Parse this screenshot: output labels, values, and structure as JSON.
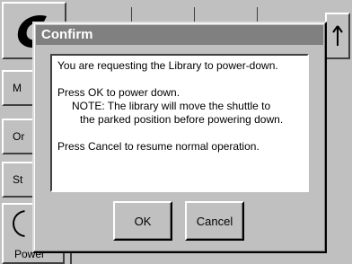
{
  "background": {
    "side_buttons": [
      {
        "label": "M"
      },
      {
        "label": "Or"
      },
      {
        "label": "St"
      }
    ],
    "power_label": "Power"
  },
  "dialog": {
    "title": "Confirm",
    "message": {
      "line1": "You are requesting the Library to power-down.",
      "line2": "Press OK to power down.",
      "note_line1": "NOTE: The library will move the shuttle to",
      "note_line2": "the parked position before powering down.",
      "line3": "Press Cancel to resume normal operation."
    },
    "ok_label": "OK",
    "cancel_label": "Cancel"
  },
  "colors": {
    "face": "#c0c0c0",
    "titlebar": "#808080",
    "message_bg": "#ffffff"
  },
  "icons": {
    "logo": "logo-icon",
    "scroll_up": "arrow-up-icon",
    "power": "power-icon"
  }
}
